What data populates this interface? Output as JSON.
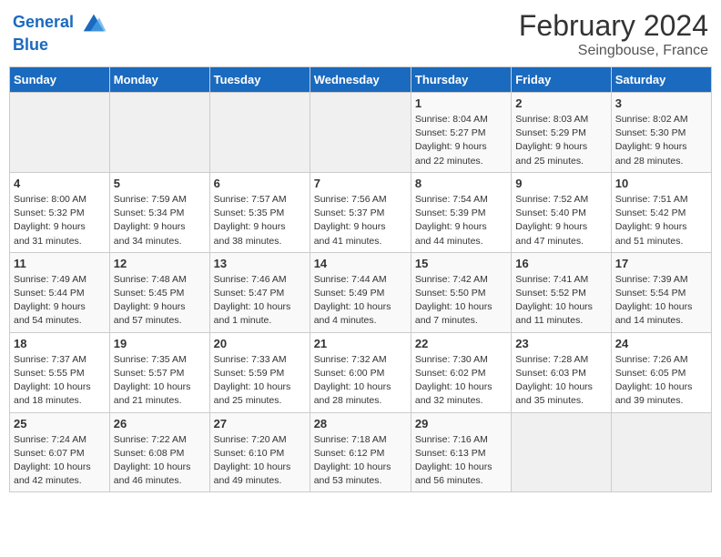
{
  "header": {
    "logo_line1": "General",
    "logo_line2": "Blue",
    "month_year": "February 2024",
    "location": "Seingbouse, France"
  },
  "weekdays": [
    "Sunday",
    "Monday",
    "Tuesday",
    "Wednesday",
    "Thursday",
    "Friday",
    "Saturday"
  ],
  "weeks": [
    [
      {
        "day": "",
        "info": ""
      },
      {
        "day": "",
        "info": ""
      },
      {
        "day": "",
        "info": ""
      },
      {
        "day": "",
        "info": ""
      },
      {
        "day": "1",
        "info": "Sunrise: 8:04 AM\nSunset: 5:27 PM\nDaylight: 9 hours\nand 22 minutes."
      },
      {
        "day": "2",
        "info": "Sunrise: 8:03 AM\nSunset: 5:29 PM\nDaylight: 9 hours\nand 25 minutes."
      },
      {
        "day": "3",
        "info": "Sunrise: 8:02 AM\nSunset: 5:30 PM\nDaylight: 9 hours\nand 28 minutes."
      }
    ],
    [
      {
        "day": "4",
        "info": "Sunrise: 8:00 AM\nSunset: 5:32 PM\nDaylight: 9 hours\nand 31 minutes."
      },
      {
        "day": "5",
        "info": "Sunrise: 7:59 AM\nSunset: 5:34 PM\nDaylight: 9 hours\nand 34 minutes."
      },
      {
        "day": "6",
        "info": "Sunrise: 7:57 AM\nSunset: 5:35 PM\nDaylight: 9 hours\nand 38 minutes."
      },
      {
        "day": "7",
        "info": "Sunrise: 7:56 AM\nSunset: 5:37 PM\nDaylight: 9 hours\nand 41 minutes."
      },
      {
        "day": "8",
        "info": "Sunrise: 7:54 AM\nSunset: 5:39 PM\nDaylight: 9 hours\nand 44 minutes."
      },
      {
        "day": "9",
        "info": "Sunrise: 7:52 AM\nSunset: 5:40 PM\nDaylight: 9 hours\nand 47 minutes."
      },
      {
        "day": "10",
        "info": "Sunrise: 7:51 AM\nSunset: 5:42 PM\nDaylight: 9 hours\nand 51 minutes."
      }
    ],
    [
      {
        "day": "11",
        "info": "Sunrise: 7:49 AM\nSunset: 5:44 PM\nDaylight: 9 hours\nand 54 minutes."
      },
      {
        "day": "12",
        "info": "Sunrise: 7:48 AM\nSunset: 5:45 PM\nDaylight: 9 hours\nand 57 minutes."
      },
      {
        "day": "13",
        "info": "Sunrise: 7:46 AM\nSunset: 5:47 PM\nDaylight: 10 hours\nand 1 minute."
      },
      {
        "day": "14",
        "info": "Sunrise: 7:44 AM\nSunset: 5:49 PM\nDaylight: 10 hours\nand 4 minutes."
      },
      {
        "day": "15",
        "info": "Sunrise: 7:42 AM\nSunset: 5:50 PM\nDaylight: 10 hours\nand 7 minutes."
      },
      {
        "day": "16",
        "info": "Sunrise: 7:41 AM\nSunset: 5:52 PM\nDaylight: 10 hours\nand 11 minutes."
      },
      {
        "day": "17",
        "info": "Sunrise: 7:39 AM\nSunset: 5:54 PM\nDaylight: 10 hours\nand 14 minutes."
      }
    ],
    [
      {
        "day": "18",
        "info": "Sunrise: 7:37 AM\nSunset: 5:55 PM\nDaylight: 10 hours\nand 18 minutes."
      },
      {
        "day": "19",
        "info": "Sunrise: 7:35 AM\nSunset: 5:57 PM\nDaylight: 10 hours\nand 21 minutes."
      },
      {
        "day": "20",
        "info": "Sunrise: 7:33 AM\nSunset: 5:59 PM\nDaylight: 10 hours\nand 25 minutes."
      },
      {
        "day": "21",
        "info": "Sunrise: 7:32 AM\nSunset: 6:00 PM\nDaylight: 10 hours\nand 28 minutes."
      },
      {
        "day": "22",
        "info": "Sunrise: 7:30 AM\nSunset: 6:02 PM\nDaylight: 10 hours\nand 32 minutes."
      },
      {
        "day": "23",
        "info": "Sunrise: 7:28 AM\nSunset: 6:03 PM\nDaylight: 10 hours\nand 35 minutes."
      },
      {
        "day": "24",
        "info": "Sunrise: 7:26 AM\nSunset: 6:05 PM\nDaylight: 10 hours\nand 39 minutes."
      }
    ],
    [
      {
        "day": "25",
        "info": "Sunrise: 7:24 AM\nSunset: 6:07 PM\nDaylight: 10 hours\nand 42 minutes."
      },
      {
        "day": "26",
        "info": "Sunrise: 7:22 AM\nSunset: 6:08 PM\nDaylight: 10 hours\nand 46 minutes."
      },
      {
        "day": "27",
        "info": "Sunrise: 7:20 AM\nSunset: 6:10 PM\nDaylight: 10 hours\nand 49 minutes."
      },
      {
        "day": "28",
        "info": "Sunrise: 7:18 AM\nSunset: 6:12 PM\nDaylight: 10 hours\nand 53 minutes."
      },
      {
        "day": "29",
        "info": "Sunrise: 7:16 AM\nSunset: 6:13 PM\nDaylight: 10 hours\nand 56 minutes."
      },
      {
        "day": "",
        "info": ""
      },
      {
        "day": "",
        "info": ""
      }
    ]
  ]
}
